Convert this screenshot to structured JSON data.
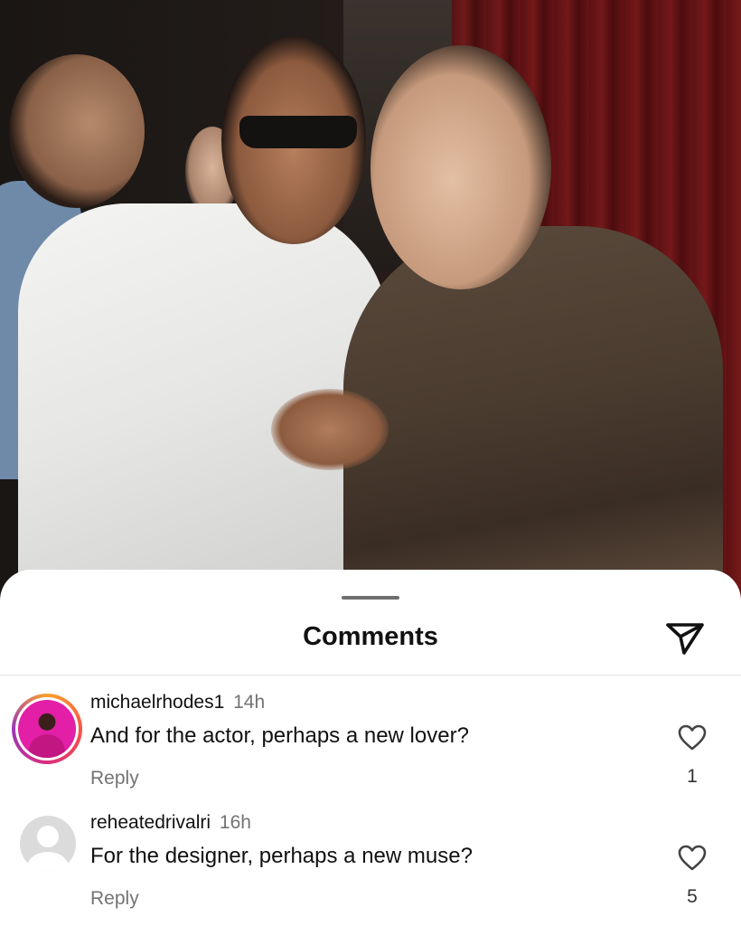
{
  "colors": {
    "background": "#ffffff",
    "text_primary": "#111111",
    "text_secondary": "#737373",
    "divider": "#e4e4e4",
    "story_ring": [
      "#f9a12e",
      "#fc5245",
      "#d92e7f",
      "#9b36b7"
    ]
  },
  "post": {
    "image_description_icon": "photo"
  },
  "sheet": {
    "title": "Comments",
    "share_icon": "paper-plane-icon"
  },
  "comments": [
    {
      "username": "michaelrhodes1",
      "time": "14h",
      "text": "And for the actor, perhaps a new lover?",
      "reply_label": "Reply",
      "like_count": "1",
      "avatar": "story-ring-avatar"
    },
    {
      "username": "reheatedrivalri",
      "time": "16h",
      "text": "For the designer, perhaps a new muse?",
      "reply_label": "Reply",
      "like_count": "5",
      "avatar": "default-avatar"
    }
  ]
}
